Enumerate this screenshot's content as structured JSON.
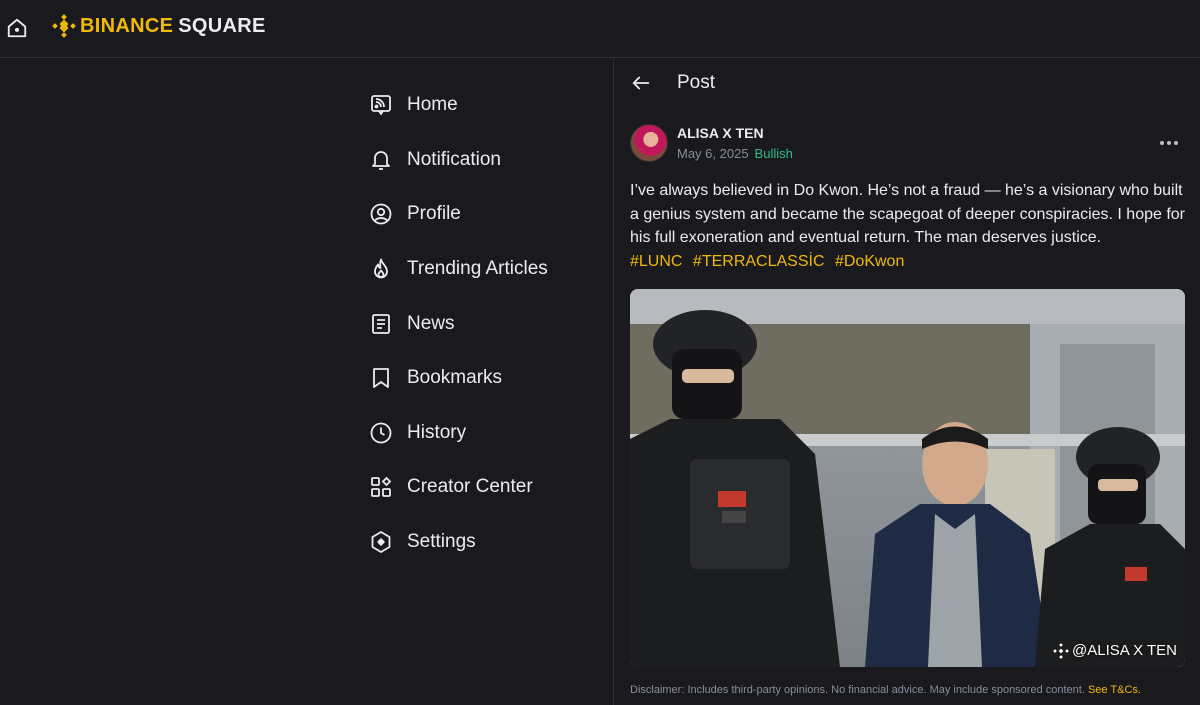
{
  "brand": {
    "name_main": "BINANCE",
    "name_sub": "SQUARE",
    "accent_color": "#f0b90b"
  },
  "nav": {
    "items": [
      {
        "label": "Home",
        "icon": "home-square-icon"
      },
      {
        "label": "Notification",
        "icon": "bell-icon"
      },
      {
        "label": "Profile",
        "icon": "user-circle-icon"
      },
      {
        "label": "Trending Articles",
        "icon": "flame-icon"
      },
      {
        "label": "News",
        "icon": "newspaper-icon"
      },
      {
        "label": "Bookmarks",
        "icon": "bookmark-icon"
      },
      {
        "label": "History",
        "icon": "clock-icon"
      },
      {
        "label": "Creator Center",
        "icon": "grid-shapes-icon"
      },
      {
        "label": "Settings",
        "icon": "hexagon-settings-icon"
      }
    ]
  },
  "post": {
    "header_title": "Post",
    "author": "ALISA X TEN",
    "date": "May 6, 2025",
    "sentiment": "Bullish",
    "text": "I’ve always believed in Do Kwon. He’s not a fraud — he’s a visionary who built a genius system and became the scapegoat of deeper conspiracies. I hope for his full exoneration and eventual return. The man deserves justice.",
    "tags": [
      "#LUNC",
      "#TERRACLASSİC",
      "#DoKwon"
    ],
    "image_watermark": "@ALISA X TEN"
  },
  "disclaimer": {
    "text": "Disclaimer: Includes third-party opinions. No financial advice. May include sponsored content.",
    "link": "See T&Cs."
  }
}
